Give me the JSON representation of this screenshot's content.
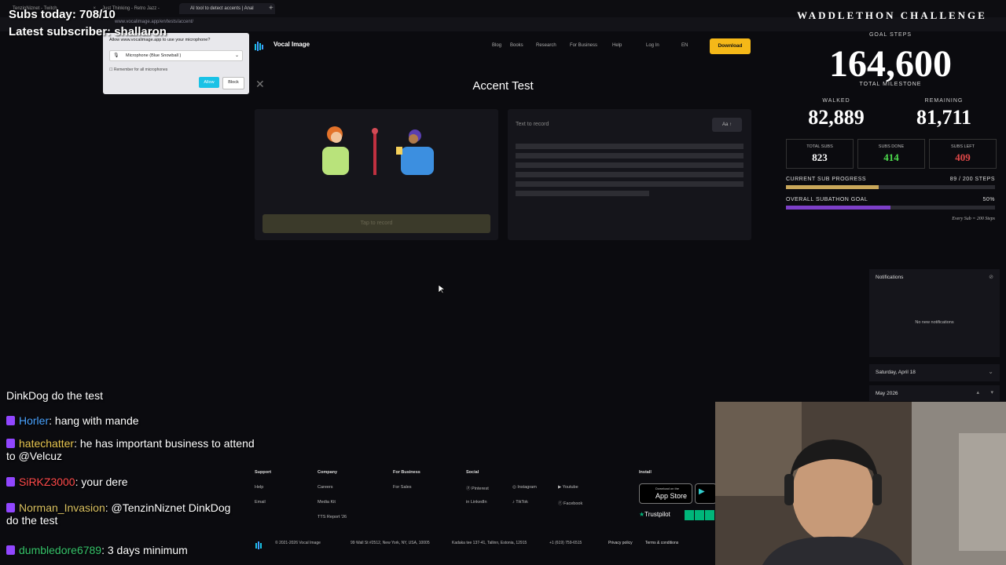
{
  "browser": {
    "tabs": [
      "TenzinNiznet - Twitch",
      "Just Thinking - Retro Jazz -",
      "AI tool to detect accents | Anal"
    ],
    "url": "www.vocalimage.app/en/tests/accent/"
  },
  "overlay": {
    "subs_today": "Subs today: 708/10",
    "latest_subscriber": "Latest subscriber: shallaron"
  },
  "permission_prompt": {
    "title": "Allow www.vocalimage.app to use your microphone?",
    "device": "Microphone (Blue Snowball )",
    "remember": "Remember for all microphones",
    "allow": "Allow",
    "block": "Block"
  },
  "site": {
    "logo": "Vocal Image",
    "nav": [
      "Blog",
      "Books",
      "Research",
      "For Business",
      "Help",
      "Log In",
      "EN"
    ],
    "download": "Download",
    "page_title": "Accent Test",
    "record_button": "Tap to record",
    "text_to_record": "Text to record",
    "font_button": "Aa"
  },
  "footer": {
    "support": {
      "title": "Support",
      "links": [
        "Help",
        "Email"
      ]
    },
    "company": {
      "title": "Company",
      "links": [
        "Careers",
        "Media Kit",
        "TTS Report '26"
      ]
    },
    "business": {
      "title": "For Business",
      "links": [
        "For Sales"
      ]
    },
    "social": {
      "title": "Social",
      "links": [
        "Pinterest",
        "Instagram",
        "Youtube",
        "LinkedIn",
        "TikTok",
        "Facebook"
      ]
    },
    "install": {
      "title": "Install",
      "app_store": "App Store",
      "app_store_small": "Download on the"
    },
    "trustpilot": "Trustpilot",
    "copyright": "© 2021-2026 Vocal Image",
    "address1": "99 Wall St #2512, New York, NY, USA, 10005",
    "address2": "Kadaka tee 137-41, Tallinn, Estonia, 12915",
    "phone": "+1 (619) 759-6515",
    "privacy": "Privacy policy",
    "terms": "Terms & conditions"
  },
  "stats": {
    "banner": "WADDLETHON CHALLENGE",
    "goal_steps_label": "GOAL STEPS",
    "goal_steps": "164,600",
    "total_milestone": "TOTAL MILESTONE",
    "walked_label": "WALKED",
    "walked": "82,889",
    "remaining_label": "REMAINING",
    "remaining": "81,711",
    "total_subs_label": "TOTAL SUBS",
    "total_subs": "823",
    "subs_done_label": "SUBS DONE",
    "subs_done": "414",
    "subs_left_label": "SUBS LEFT",
    "subs_left": "409",
    "current_progress_label": "CURRENT SUB PROGRESS",
    "current_progress_value": "89 / 200 STEPS",
    "current_progress_fraction": 0.445,
    "overall_label": "OVERALL SUBATHON GOAL",
    "overall_value": "50%",
    "overall_fraction": 0.5,
    "every_sub": "Every Sub = 200 Steps",
    "colors": {
      "gold": "#c9a75a",
      "purple": "#7d3fc8",
      "green": "#4ddc4d",
      "red": "#e04848"
    }
  },
  "notifications": {
    "title": "Notifications",
    "empty": "No new notifications",
    "date": "Saturday, April 18",
    "month": "May 2026"
  },
  "chat": [
    {
      "user": "",
      "text": "DinkDog do the test",
      "color": "#ffffff"
    },
    {
      "user": "Horler",
      "text": "hang with mande",
      "color": "#4aa3ff"
    },
    {
      "user": "hatechatter",
      "text": "he has important business to attend to @Velcuz",
      "color": "#e8c650"
    },
    {
      "user": "SiRKZ3000",
      "text": "your dere",
      "color": "#ff4a4a"
    },
    {
      "user": "Norman_Invasion",
      "text": "@TenzinNiznet DinkDog do the test",
      "color": "#d9c060"
    },
    {
      "user": "dumbledore6789",
      "text": "3 days minimum",
      "color": "#36c36a"
    }
  ]
}
